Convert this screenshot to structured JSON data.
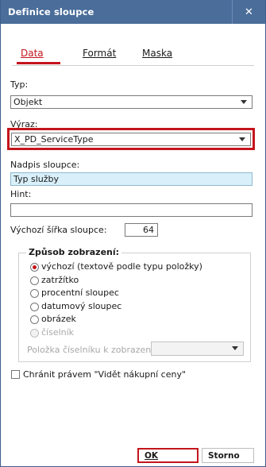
{
  "window": {
    "title": "Definice sloupce",
    "close_glyph": "✕"
  },
  "tabs": [
    {
      "label": "Data",
      "active": true
    },
    {
      "label": "Formát",
      "active": false
    },
    {
      "label": "Maska",
      "active": false
    }
  ],
  "typ": {
    "label": "Typ:",
    "value": "Objekt"
  },
  "vyraz": {
    "label": "Výraz:",
    "value": "X_PD_ServiceType"
  },
  "nadpis": {
    "label": "Nadpis sloupce:",
    "value": "Typ služby"
  },
  "hint": {
    "label": "Hint:",
    "value": ""
  },
  "sirka": {
    "label": "Výchozí šířka sloupce:",
    "value": "64"
  },
  "zpusob": {
    "title": "Způsob zobrazení:",
    "options": [
      {
        "label": "výchozí (textově podle typu položky)",
        "checked": true,
        "disabled": false
      },
      {
        "label": "zatržítko",
        "checked": false,
        "disabled": false
      },
      {
        "label": "procentní sloupec",
        "checked": false,
        "disabled": false
      },
      {
        "label": "datumový sloupec",
        "checked": false,
        "disabled": false
      },
      {
        "label": "obrázek",
        "checked": false,
        "disabled": false
      },
      {
        "label": "číselník",
        "checked": false,
        "disabled": true
      }
    ],
    "ciselnik_label": "Položka číselníku k zobrazení:",
    "ciselnik_value": ""
  },
  "chranit": {
    "label": "Chránit právem \"Vidět nákupní ceny\"",
    "checked": false
  },
  "buttons": {
    "ok": "OK",
    "cancel": "Storno"
  },
  "colors": {
    "titlebar": "#4a6d9a",
    "accent": "#c4151c",
    "highlight_field": "#d9f0fb"
  }
}
